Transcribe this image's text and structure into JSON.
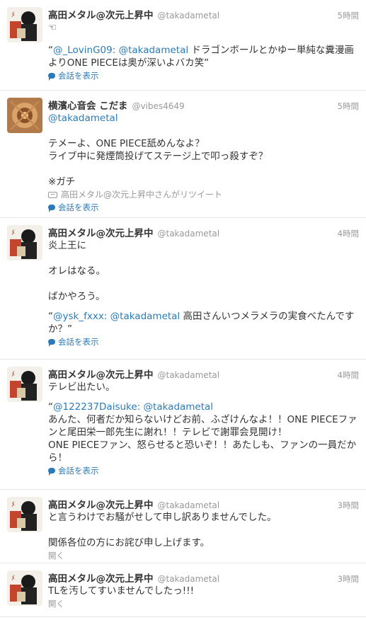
{
  "tweets": [
    {
      "name": "高田メタル@次元上昇中",
      "handle": "@takadametal",
      "time": "5時間",
      "lines": [
        "☜"
      ],
      "quote": {
        "prefix": "“",
        "link": "@_LovinG09: @takadametal",
        "text": " ドラゴンボールとかゆー単純な糞漫画よりONE PIECEは奥が深いよバカ笑”"
      },
      "action": "会話を表示"
    },
    {
      "name": "横濱心音会 こだま",
      "handle": "@vibes4649",
      "time": "5時間",
      "mention": "@takadametal",
      "lines": [
        "テメーよ、ONE PIECE舐めんなよ？",
        "ライブ中に発煙筒投げてステージ上で叩っ殺すぞ？",
        "",
        "※ガチ"
      ],
      "retweet": "高田メタル@次元上昇中さんがリツイート",
      "action": "会話を表示"
    },
    {
      "name": "高田メタル@次元上昇中",
      "handle": "@takadametal",
      "time": "4時間",
      "lines": [
        "炎上王に",
        "",
        "オレはなる。",
        "",
        "ばかやろう。"
      ],
      "quote": {
        "prefix": "“",
        "link": "@ysk_fxxx: @takadametal",
        "text": " 高田さんいつメラメラの実食べたんですか？”"
      },
      "action": "会話を表示"
    },
    {
      "name": "高田メタル@次元上昇中",
      "handle": "@takadametal",
      "time": "4時間",
      "lines": [
        "テレビ出たい。"
      ],
      "quote": {
        "prefix": "“",
        "link": "@122237Daisuke: @takadametal",
        "text": "",
        "lines": [
          "あんた、何者だか知らないけどお前、ふざけんなよ！！ONE PIECEファンと尾田栄一郎先生に謝れ！！テレビで謝罪会見開け！",
          "ONE PIECEファン、怒らせると恐いぞ！！あたしも、ファンの一員だから！"
        ]
      },
      "action": "会話を表示"
    },
    {
      "name": "高田メタル@次元上昇中",
      "handle": "@takadametal",
      "time": "3時間",
      "lines": [
        "と言うわけでお騒がせして申し訳ありませんでした。",
        "",
        "関係各位の方にお詫び申し上げます。"
      ],
      "action_grey": "開く"
    },
    {
      "name": "高田メタル@次元上昇中",
      "handle": "@takadametal",
      "time": "3時間",
      "lines": [
        "TLを汚してすいませんでしたっ!!!"
      ],
      "action_grey": "開く"
    }
  ],
  "colors": {
    "link": "#2b7bb9",
    "meta": "#999999",
    "text": "#333333",
    "divider": "#e8e8e8"
  },
  "icons": {
    "conversation": "speech-bubble-icon",
    "retweet": "retweet-icon"
  }
}
